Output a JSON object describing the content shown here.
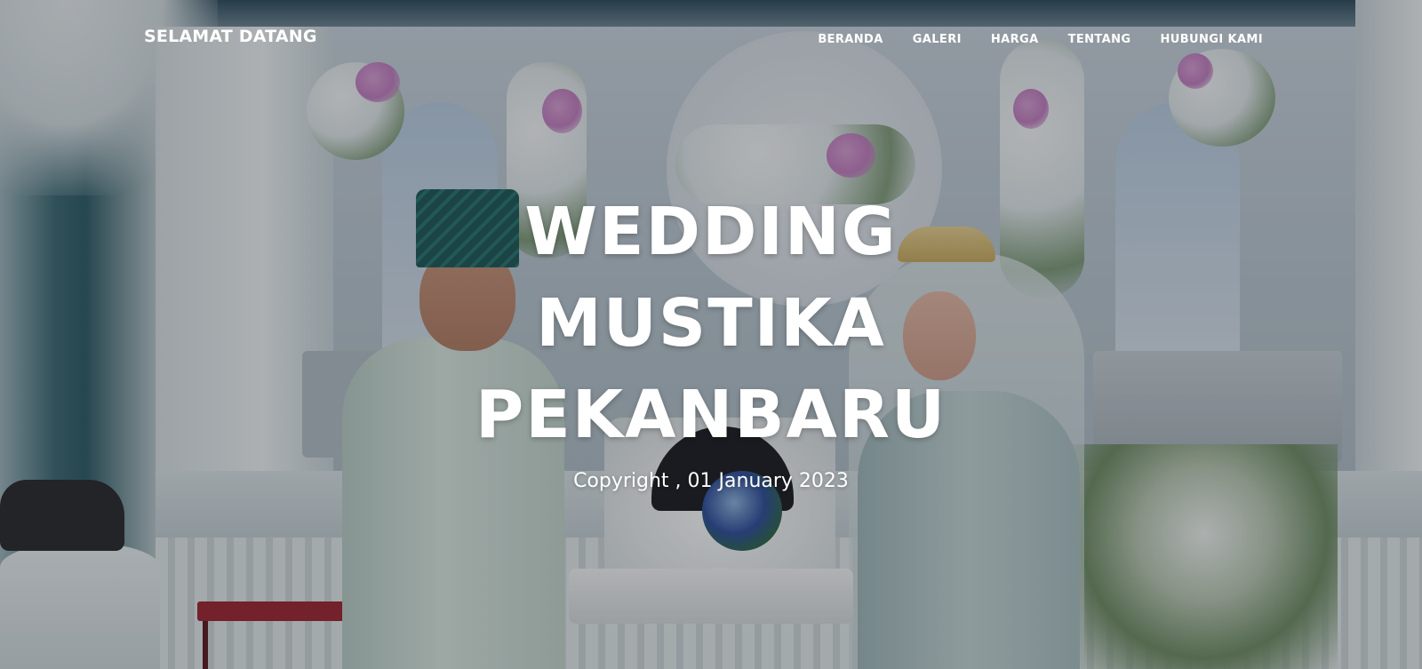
{
  "navbar": {
    "brand": "SELAMAT DATANG",
    "links": [
      "BERANDA",
      "GALERI",
      "HARGA",
      "TENTANG",
      "HUBUNGI KAMI"
    ]
  },
  "hero": {
    "title_lines": [
      "WEDDING",
      "MUSTIKA",
      "PEKANBARU"
    ],
    "subtitle": "Copyright , 01 January 2023"
  }
}
